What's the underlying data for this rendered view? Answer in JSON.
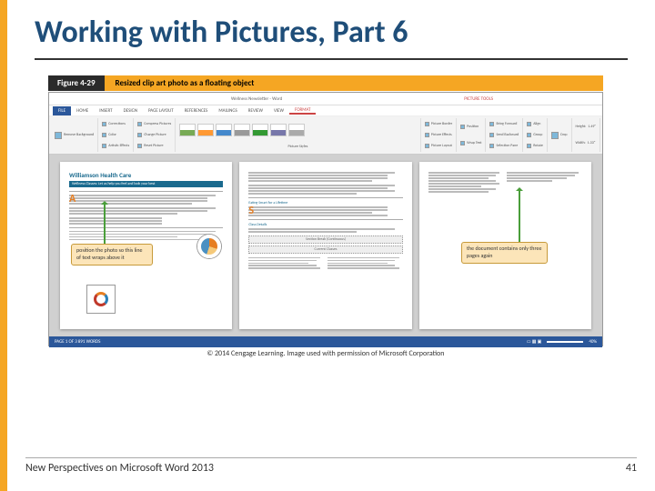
{
  "title": "Working with Pictures, Part 6",
  "figure": {
    "label": "Figure 4-29",
    "caption": "Resized clip art photo as a floating object"
  },
  "titlebar": {
    "doc": "Wellness Newsletter - Word",
    "tools": "PICTURE TOOLS"
  },
  "tabs": {
    "file": "FILE",
    "home": "HOME",
    "insert": "INSERT",
    "design": "DESIGN",
    "pagelayout": "PAGE LAYOUT",
    "references": "REFERENCES",
    "mailings": "MAILINGS",
    "review": "REVIEW",
    "view": "VIEW",
    "format": "FORMAT"
  },
  "ribbon": {
    "removebg": "Remove Background",
    "corrections": "Corrections",
    "color": "Color",
    "artistic": "Artistic Effects",
    "compress": "Compress Pictures",
    "change": "Change Picture",
    "reset": "Reset Picture",
    "styles_label": "Picture Styles",
    "border": "Picture Border",
    "effects": "Picture Effects",
    "layout": "Picture Layout",
    "position": "Position",
    "wrap": "Wrap Text",
    "forward": "Bring Forward",
    "backward": "Send Backward",
    "selection": "Selection Pane",
    "align": "Align",
    "group": "Group",
    "rotate": "Rotate",
    "crop": "Crop",
    "height": "Height:",
    "hval": "1.49\"",
    "width": "Width:",
    "wval": "1.33\""
  },
  "page1": {
    "head": "Williamson Health Care",
    "sub": "Wellness Classes: Let us help you feel and look your best"
  },
  "page2": {
    "heading1": "Eating Smart for a Lifetime",
    "heading2": "Class Details",
    "section": "Section Break (Continuous)",
    "section2": "Current Classes"
  },
  "callouts": {
    "left": "position the photo so this line of text wraps above it",
    "right": "the document contains only three pages again"
  },
  "status": {
    "left": "PAGE 1 OF 3   891 WORDS",
    "zoom": "40%"
  },
  "copyright": "© 2014 Cengage Learning. Image used with permission of Microsoft Corporation",
  "footer": {
    "left": "New Perspectives on Microsoft Word 2013",
    "right": "41"
  }
}
